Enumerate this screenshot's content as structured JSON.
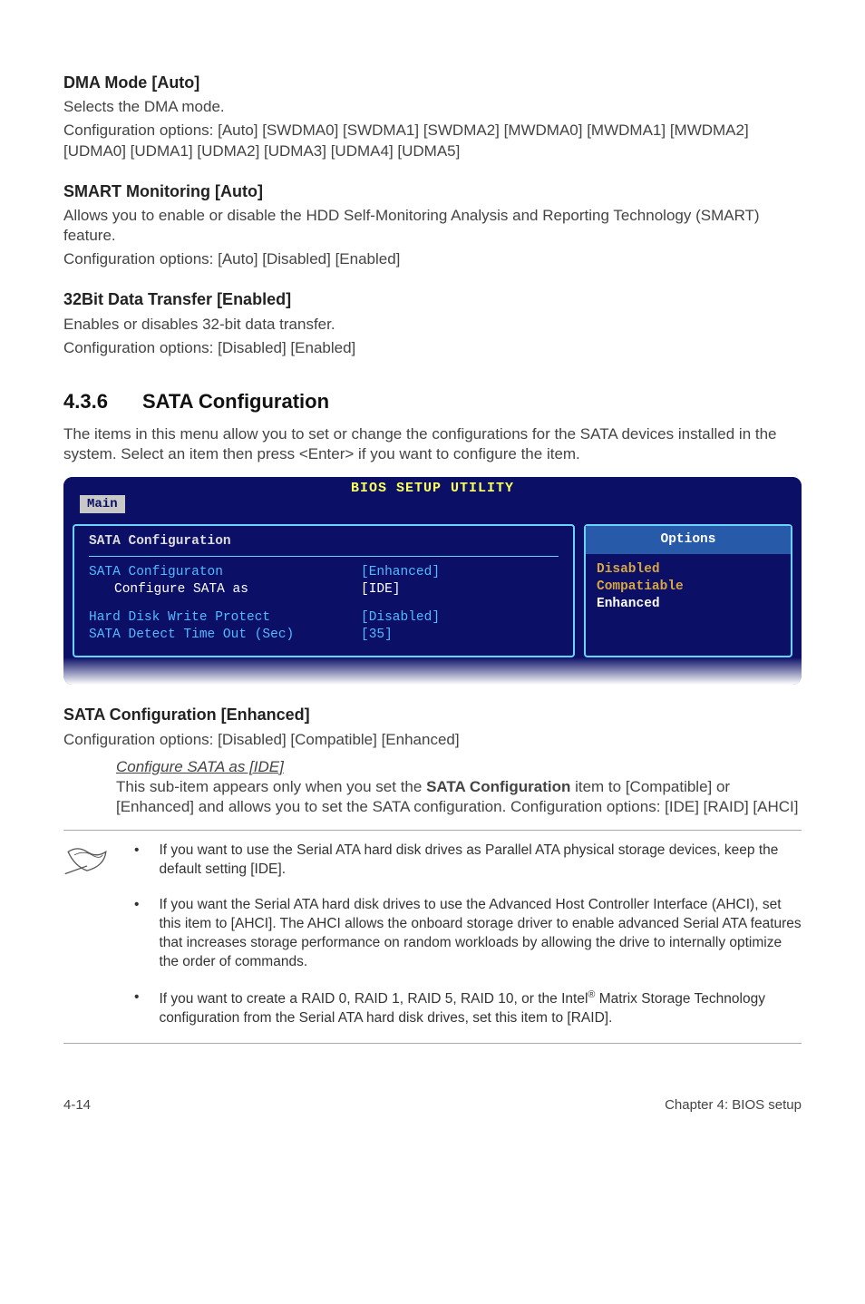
{
  "dma": {
    "heading": "DMA Mode [Auto]",
    "line1": "Selects the DMA mode.",
    "line2": "Configuration options: [Auto] [SWDMA0] [SWDMA1] [SWDMA2] [MWDMA0] [MWDMA1] [MWDMA2] [UDMA0] [UDMA1] [UDMA2] [UDMA3] [UDMA4] [UDMA5]"
  },
  "smart": {
    "heading": "SMART Monitoring [Auto]",
    "line1": "Allows you to enable or disable the HDD Self-Monitoring Analysis and Reporting Technology (SMART) feature.",
    "line2": "Configuration options: [Auto] [Disabled] [Enabled]"
  },
  "bit32": {
    "heading": "32Bit Data Transfer [Enabled]",
    "line1": "Enables or disables 32-bit data transfer.",
    "line2": "Configuration options: [Disabled] [Enabled]"
  },
  "section": {
    "num": "4.3.6",
    "title": "SATA Configuration",
    "intro": "The items in this menu allow you to set or change the configurations for the SATA devices installed in the system. Select an item then press <Enter> if you want to configure the item."
  },
  "bios": {
    "header": "BIOS SETUP UTILITY",
    "tab": "Main",
    "left_header": "SATA Configuration",
    "row1_label": "SATA Configuraton",
    "row1_value": "[Enhanced]",
    "row2_label": "Configure SATA as",
    "row2_value": "[IDE]",
    "row3_label": "Hard Disk Write Protect",
    "row3_value": "[Disabled]",
    "row4_label": "SATA Detect Time Out (Sec)",
    "row4_value": "[35]",
    "options_header": "Options",
    "opt1": "Disabled",
    "opt2": "Compatiable",
    "opt3": "Enhanced"
  },
  "sata_enh": {
    "heading": "SATA Configuration [Enhanced]",
    "line1": "Configuration options: [Disabled] [Compatible] [Enhanced]"
  },
  "sub": {
    "underline": "Configure SATA as [IDE]",
    "p1a": "This sub-item appears only when you set the ",
    "p1bold": "SATA Configuration",
    "p1b": " item to [Compatible] or [Enhanced] and allows you to set the SATA configuration. Configuration options: [IDE] [RAID] [AHCI]"
  },
  "notes": {
    "n1": "If you want to use the Serial ATA hard disk drives as Parallel ATA physical storage devices, keep the default setting [IDE].",
    "n2": "If you want the Serial ATA hard disk drives to use the Advanced Host Controller Interface (AHCI), set this item to [AHCI]. The AHCI allows the onboard storage driver to enable advanced Serial ATA features that increases storage performance on random workloads by allowing the drive to internally optimize the order of commands.",
    "n3a": "If you want to create a RAID 0, RAID 1, RAID 5, RAID 10, or the Intel",
    "n3b": " Matrix Storage Technology configuration from the Serial ATA hard disk drives, set this item to [RAID]."
  },
  "footer": {
    "left": "4-14",
    "right": "Chapter 4: BIOS setup"
  }
}
